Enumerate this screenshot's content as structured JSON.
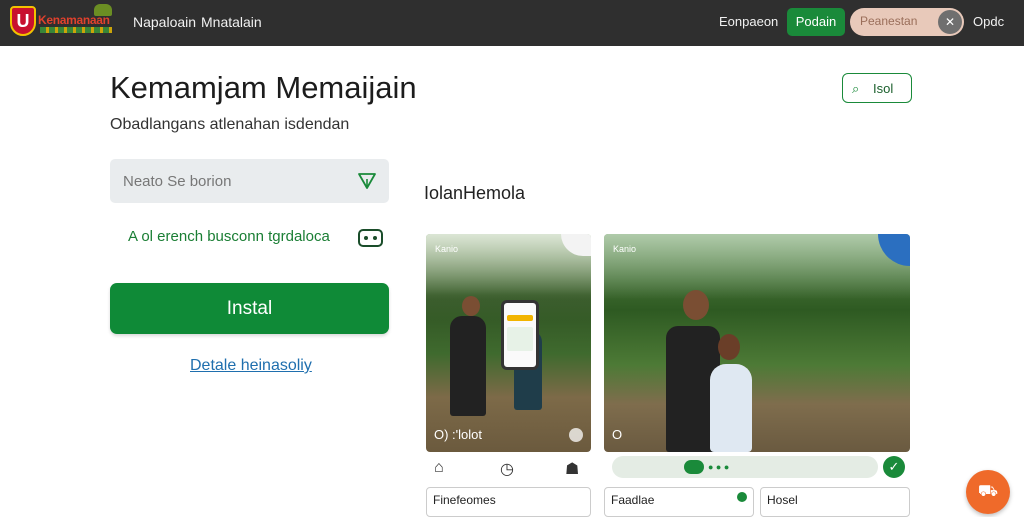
{
  "header": {
    "logo_text": "Kenamanaan",
    "nav": [
      "Napaloain",
      "Mnatalain"
    ],
    "right_text": "Eonpaeon",
    "green_button": "Podain",
    "search_pill_text": "Peanestan",
    "search_close": "✕",
    "options": "Opdc"
  },
  "main": {
    "title": "Kemamjam Memaijain",
    "subtitle": "Obadlangans atlenahan isdendan",
    "search_placeholder": "Neato Se borion",
    "info_text": "A ol erench busconn tgrdaloca",
    "install_label": "Instal",
    "detail_link": "Detale heinasoliy"
  },
  "right": {
    "label_button": "Isol",
    "label_button_icon": "pin-icon",
    "section_title": "IolanHemola",
    "cards": [
      {
        "label": "Kanio",
        "time": "O) :'lolot"
      },
      {
        "label": "Kanio",
        "time": "O"
      }
    ],
    "bottom_icons": [
      "home-icon",
      "clock-icon",
      "profile-icon"
    ],
    "mini_cards": [
      "Finefeomes",
      "Faadlae",
      "Hosel"
    ]
  },
  "colors": {
    "topbar": "#2f2f2f",
    "accent_green": "#0f8a37",
    "link_blue": "#1f6fae",
    "fab_orange": "#ef6a2a"
  }
}
